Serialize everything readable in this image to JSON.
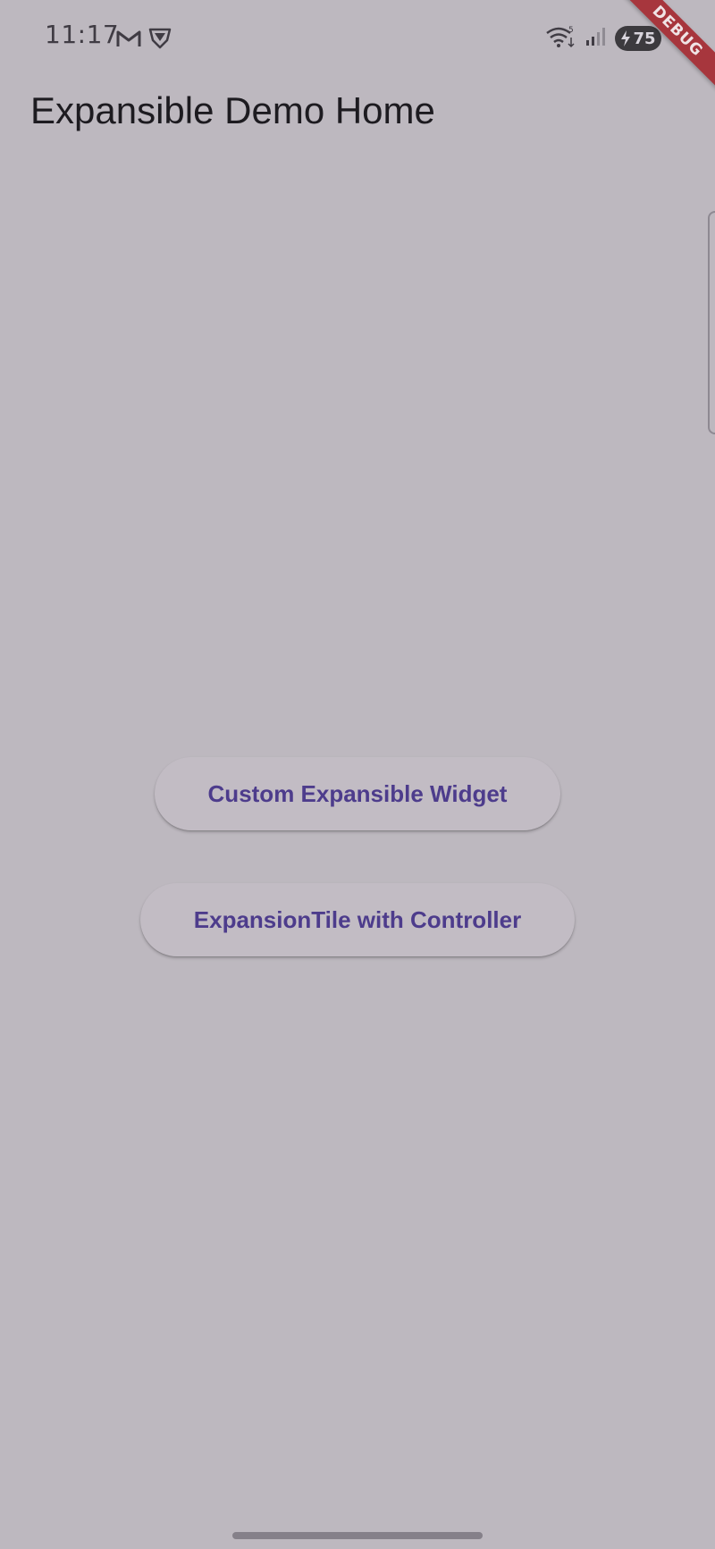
{
  "status_bar": {
    "time": "11:17",
    "left_icons": [
      "gmail-icon",
      "vpn-shield-icon"
    ],
    "right_icons": [
      "wifi-icon",
      "signal-icon",
      "battery-icon"
    ],
    "battery_level": "75"
  },
  "debug_banner": {
    "label": "DEBUG"
  },
  "app_bar": {
    "title": "Expansible Demo Home"
  },
  "buttons": {
    "custom_expansible": "Custom Expansible Widget",
    "expansion_tile": "ExpansionTile with Controller"
  },
  "colors": {
    "background": "#bdb8bf",
    "button_text": "#4d3c8c",
    "debug_banner": "#a7363d"
  }
}
